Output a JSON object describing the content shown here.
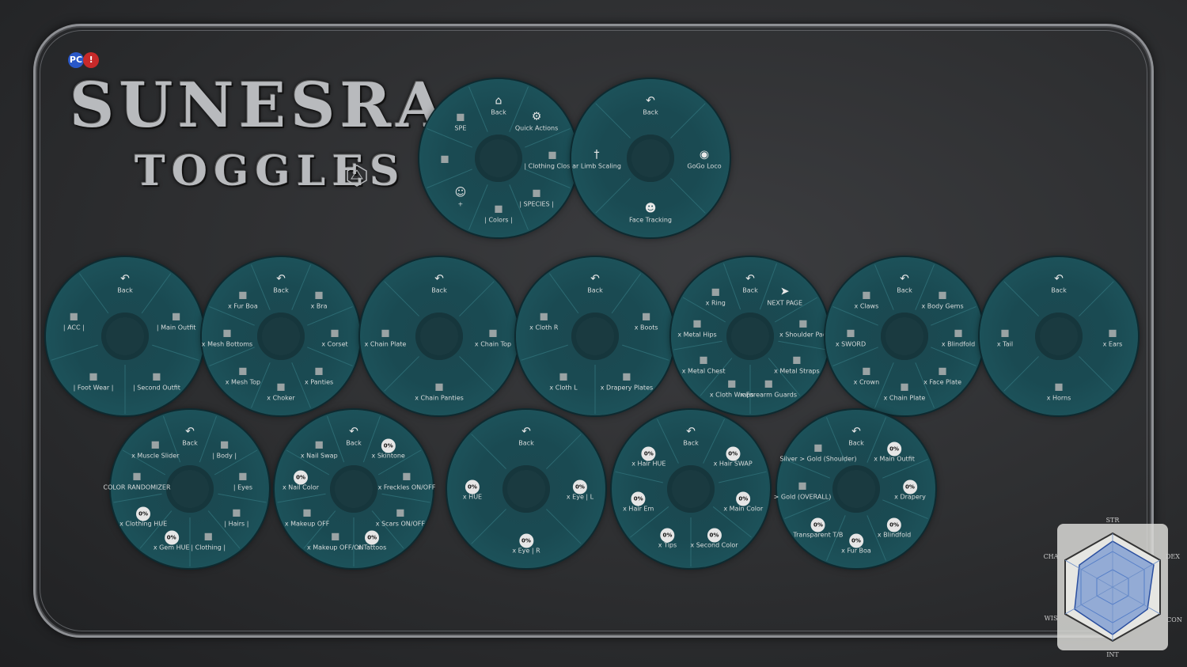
{
  "branding": {
    "title": "SUNESRA",
    "subtitle": "TOGGLES",
    "badge_left": "PC",
    "badge_right": "!"
  },
  "wheels": [
    {
      "id": "main",
      "items": [
        {
          "label": "Back",
          "icon": "home-icon",
          "kind": "nav"
        },
        {
          "label": "Quick Actions",
          "icon": "gear-icon",
          "kind": "nav"
        },
        {
          "label": "| Clothing Closet |",
          "icon": "closet-icon",
          "kind": "sub"
        },
        {
          "label": "| SPECIES |",
          "icon": "species-icon",
          "kind": "sub"
        },
        {
          "label": "| Colors |",
          "icon": "colors-icon",
          "kind": "sub"
        },
        {
          "label": "+",
          "icon": "person-icon",
          "kind": "sub"
        },
        {
          "label": "",
          "icon": "avatar-icon",
          "kind": "sub"
        },
        {
          "label": "SPE",
          "icon": "spe-icon",
          "kind": "sub"
        }
      ]
    },
    {
      "id": "quick-actions",
      "items": [
        {
          "label": "Back",
          "icon": "back-arrow-icon",
          "kind": "nav"
        },
        {
          "label": "GoGo Loco",
          "icon": "gogo-loco-icon",
          "kind": "sub"
        },
        {
          "label": "Face Tracking",
          "icon": "face-tracking-icon",
          "kind": "sub"
        },
        {
          "label": "ar Limb Scaling",
          "icon": "limb-scaling-icon",
          "kind": "sub"
        }
      ]
    },
    {
      "id": "clothing",
      "items": [
        {
          "label": "Back",
          "icon": "back-arrow-icon",
          "kind": "nav"
        },
        {
          "label": "| Main Outfit",
          "icon": "outfit-icon",
          "kind": "sub"
        },
        {
          "label": "| Second Outfit",
          "icon": "outfit-icon",
          "kind": "sub"
        },
        {
          "label": "| Foot Wear |",
          "icon": "boot-icon",
          "kind": "sub"
        },
        {
          "label": "| ACC |",
          "icon": "accessory-icon",
          "kind": "sub"
        }
      ]
    },
    {
      "id": "outfit-1",
      "items": [
        {
          "label": "Back",
          "icon": "back-arrow-icon",
          "kind": "nav"
        },
        {
          "label": "x Bra",
          "icon": "bra-icon",
          "kind": "toggle"
        },
        {
          "label": "x Corset",
          "icon": "corset-icon",
          "kind": "toggle"
        },
        {
          "label": "x Panties",
          "icon": "panties-icon",
          "kind": "toggle"
        },
        {
          "label": "x Choker",
          "icon": "choker-icon",
          "kind": "toggle"
        },
        {
          "label": "x Mesh Top",
          "icon": "mesh-icon",
          "kind": "toggle"
        },
        {
          "label": "x Mesh Bottoms",
          "icon": "mesh-icon",
          "kind": "toggle"
        },
        {
          "label": "x Fur Boa",
          "icon": "fur-icon",
          "kind": "toggle"
        }
      ]
    },
    {
      "id": "outfit-2",
      "items": [
        {
          "label": "Back",
          "icon": "back-arrow-icon",
          "kind": "nav"
        },
        {
          "label": "x Chain Top",
          "icon": "chain-icon",
          "kind": "toggle"
        },
        {
          "label": "x Chain Panties",
          "icon": "chain-icon",
          "kind": "toggle"
        },
        {
          "label": "x Chain Plate",
          "icon": "chain-icon",
          "kind": "toggle"
        }
      ]
    },
    {
      "id": "footwear",
      "items": [
        {
          "label": "Back",
          "icon": "back-arrow-icon",
          "kind": "nav"
        },
        {
          "label": "x Boots",
          "icon": "boot-icon",
          "kind": "toggle"
        },
        {
          "label": "x Drapery Plates",
          "icon": "drapery-icon",
          "kind": "toggle"
        },
        {
          "label": "x Cloth L",
          "icon": "cloth-icon",
          "kind": "toggle"
        },
        {
          "label": "x Cloth R",
          "icon": "cloth-icon",
          "kind": "toggle"
        }
      ]
    },
    {
      "id": "acc-1",
      "items": [
        {
          "label": "Back",
          "icon": "back-arrow-icon",
          "kind": "nav"
        },
        {
          "label": "NEXT PAGE",
          "icon": "next-page-icon",
          "kind": "sub"
        },
        {
          "label": "x Shoulder Pad",
          "icon": "shoulder-icon",
          "kind": "toggle"
        },
        {
          "label": "x Metal Straps",
          "icon": "strap-icon",
          "kind": "toggle"
        },
        {
          "label": "x Forearm Guards",
          "icon": "guard-icon",
          "kind": "toggle"
        },
        {
          "label": "x Cloth Wraps",
          "icon": "wrap-icon",
          "kind": "toggle"
        },
        {
          "label": "x Metal Chest",
          "icon": "chest-icon",
          "kind": "toggle"
        },
        {
          "label": "x Metal Hips",
          "icon": "hips-icon",
          "kind": "toggle"
        },
        {
          "label": "x Ring",
          "icon": "ring-icon",
          "kind": "toggle"
        }
      ]
    },
    {
      "id": "acc-2",
      "items": [
        {
          "label": "Back",
          "icon": "back-arrow-icon",
          "kind": "nav"
        },
        {
          "label": "x Body Gems",
          "icon": "gem-icon",
          "kind": "toggle"
        },
        {
          "label": "x Blindfold",
          "icon": "blindfold-icon",
          "kind": "toggle"
        },
        {
          "label": "x Face Plate",
          "icon": "face-plate-icon",
          "kind": "toggle"
        },
        {
          "label": "x Chain Plate",
          "icon": "chain-icon",
          "kind": "toggle"
        },
        {
          "label": "x Crown",
          "icon": "crown-icon",
          "kind": "toggle"
        },
        {
          "label": "x SWORD",
          "icon": "sword-icon",
          "kind": "toggle"
        },
        {
          "label": "x Claws",
          "icon": "claw-icon",
          "kind": "toggle"
        }
      ]
    },
    {
      "id": "species",
      "items": [
        {
          "label": "Back",
          "icon": "back-arrow-icon",
          "kind": "nav"
        },
        {
          "label": "x Ears",
          "icon": "ear-icon",
          "kind": "toggle"
        },
        {
          "label": "x Horns",
          "icon": "horn-icon",
          "kind": "toggle"
        },
        {
          "label": "x Tail",
          "icon": "tail-icon",
          "kind": "toggle"
        }
      ]
    },
    {
      "id": "colors",
      "items": [
        {
          "label": "Back",
          "icon": "back-arrow-icon",
          "kind": "nav"
        },
        {
          "label": "| Body |",
          "icon": "body-icon",
          "kind": "sub"
        },
        {
          "label": "| Eyes",
          "icon": "eye-icon",
          "kind": "sub"
        },
        {
          "label": "| Hairs |",
          "icon": "hair-icon",
          "kind": "sub"
        },
        {
          "label": "| Clothing |",
          "icon": "closet-icon",
          "kind": "sub"
        },
        {
          "label": "x Gem HUE",
          "icon": "radial-icon",
          "kind": "radial",
          "value": "0%"
        },
        {
          "label": "x Clothing HUE",
          "icon": "radial-icon",
          "kind": "radial",
          "value": "0%"
        },
        {
          "label": "COLOR RANDOMIZER",
          "icon": "randomizer-icon",
          "kind": "toggle"
        },
        {
          "label": "x Muscle Slider",
          "icon": "muscle-icon",
          "kind": "toggle"
        }
      ]
    },
    {
      "id": "body",
      "items": [
        {
          "label": "Back",
          "icon": "back-arrow-icon",
          "kind": "nav"
        },
        {
          "label": "x Skintone",
          "icon": "radial-icon",
          "kind": "radial",
          "value": "0%"
        },
        {
          "label": "x Freckles ON/OFF",
          "icon": "freckles-icon",
          "kind": "toggle"
        },
        {
          "label": "x Scars ON/OFF",
          "icon": "scars-icon",
          "kind": "toggle"
        },
        {
          "label": "x Tattoos",
          "icon": "radial-icon",
          "kind": "radial",
          "value": "0%"
        },
        {
          "label": "x Makeup OFF/ON",
          "icon": "makeup-icon",
          "kind": "toggle"
        },
        {
          "label": "x Makeup OFF",
          "icon": "lips-icon",
          "kind": "toggle"
        },
        {
          "label": "x Nail Color",
          "icon": "radial-icon",
          "kind": "radial",
          "value": "0%"
        },
        {
          "label": "x Nail Swap",
          "icon": "nail-icon",
          "kind": "toggle"
        }
      ]
    },
    {
      "id": "eyes",
      "items": [
        {
          "label": "Back",
          "icon": "back-arrow-icon",
          "kind": "nav"
        },
        {
          "label": "x Eye | L",
          "icon": "radial-icon",
          "kind": "radial",
          "value": "0%"
        },
        {
          "label": "x Eye | R",
          "icon": "radial-icon",
          "kind": "radial",
          "value": "0%"
        },
        {
          "label": "x HUE",
          "icon": "radial-icon",
          "kind": "radial",
          "value": "0%"
        }
      ]
    },
    {
      "id": "hairs",
      "items": [
        {
          "label": "Back",
          "icon": "back-arrow-icon",
          "kind": "nav"
        },
        {
          "label": "x Hair SWAP",
          "icon": "radial-icon",
          "kind": "radial",
          "value": "0%"
        },
        {
          "label": "x Main Color",
          "icon": "radial-icon",
          "kind": "radial",
          "value": "0%"
        },
        {
          "label": "x Second Color",
          "icon": "radial-icon",
          "kind": "radial",
          "value": "0%"
        },
        {
          "label": "x Tips",
          "icon": "radial-icon",
          "kind": "radial",
          "value": "0%"
        },
        {
          "label": "x Hair Em",
          "icon": "radial-icon",
          "kind": "radial",
          "value": "0%"
        },
        {
          "label": "x Hair HUE",
          "icon": "radial-icon",
          "kind": "radial",
          "value": "0%"
        }
      ]
    },
    {
      "id": "clothing-colors",
      "items": [
        {
          "label": "Back",
          "icon": "back-arrow-icon",
          "kind": "nav"
        },
        {
          "label": "x Main Outfit",
          "icon": "radial-icon",
          "kind": "radial",
          "value": "0%"
        },
        {
          "label": "x Drapery",
          "icon": "radial-icon",
          "kind": "radial",
          "value": "0%"
        },
        {
          "label": "x Blindfold",
          "icon": "radial-icon",
          "kind": "radial",
          "value": "0%"
        },
        {
          "label": "x Fur Boa",
          "icon": "radial-icon",
          "kind": "radial",
          "value": "0%"
        },
        {
          "label": "Transparent T/B",
          "icon": "radial-icon",
          "kind": "radial",
          "value": "0%"
        },
        {
          "label": "> Gold (OVERALL)",
          "icon": "gold-icon",
          "kind": "toggle"
        },
        {
          "label": "Silver > Gold (Shoulder)",
          "icon": "gold-icon",
          "kind": "toggle"
        }
      ]
    }
  ],
  "radar": {
    "labels": [
      "STR",
      "DEX",
      "CON",
      "INT",
      "WIS",
      "CHA"
    ]
  },
  "colors": {
    "wheel": "#1d535b",
    "frame": "#8e9094",
    "accent": "#3f6fc8"
  }
}
